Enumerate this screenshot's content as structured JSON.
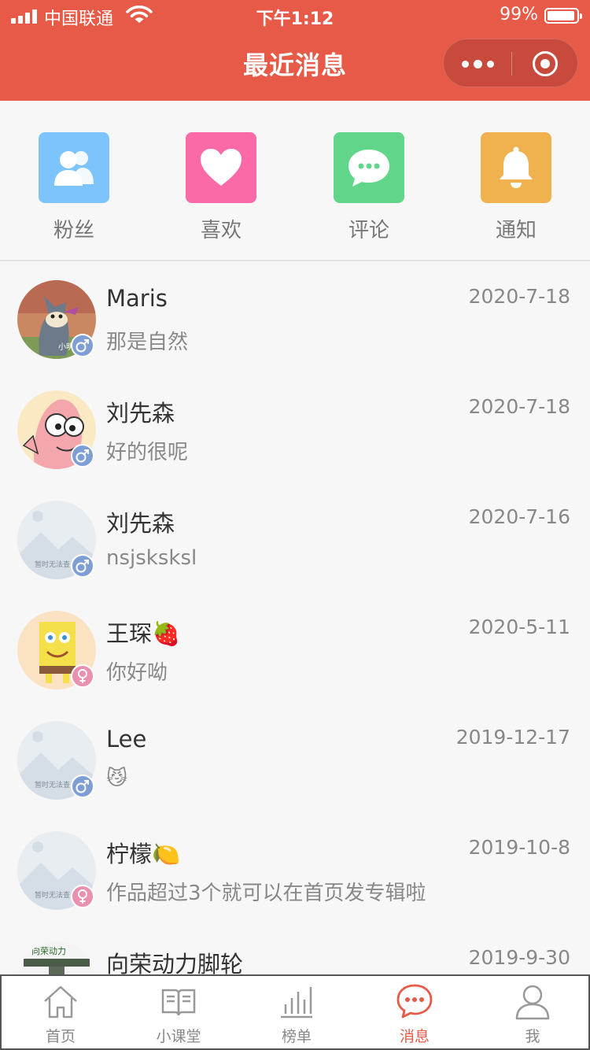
{
  "status_bar": {
    "carrier": "中国联通",
    "time": "下午1:12",
    "battery": "99%"
  },
  "header": {
    "title": "最近消息",
    "accent_color": "#e75a48"
  },
  "categories": [
    {
      "label": "粉丝",
      "icon": "fans-icon",
      "color": "#7cc4fb"
    },
    {
      "label": "喜欢",
      "icon": "heart-icon",
      "color": "#fb6aa6"
    },
    {
      "label": "评论",
      "icon": "comment-icon",
      "color": "#61d68a"
    },
    {
      "label": "通知",
      "icon": "bell-icon",
      "color": "#efb24e"
    }
  ],
  "messages": [
    {
      "name": "Maris",
      "preview": "那是自然",
      "date": "2020-7-18",
      "gender": "male",
      "avatar": "cartoon-cat-avatar"
    },
    {
      "name": "刘先森",
      "preview": "好的很呢",
      "date": "2020-7-18",
      "gender": "male",
      "avatar": "pink-starfish-avatar"
    },
    {
      "name": "刘先森",
      "preview": "nsjsksksl",
      "date": "2020-7-16",
      "gender": "male",
      "avatar": "placeholder-avatar"
    },
    {
      "name": "王琛🍓",
      "preview": "你好呦",
      "date": "2020-5-11",
      "gender": "female",
      "avatar": "yellow-sponge-avatar"
    },
    {
      "name": "Lee",
      "preview": "😼",
      "date": "2019-12-17",
      "gender": "male",
      "avatar": "placeholder-avatar"
    },
    {
      "name": "柠檬🍋",
      "preview": "作品超过3个就可以在首页发专辑啦",
      "date": "2019-10-8",
      "gender": "female",
      "avatar": "placeholder-avatar"
    },
    {
      "name": "向荣动力脚轮",
      "preview": "",
      "date": "2019-9-30",
      "gender": "",
      "avatar": "caster-wheel-avatar"
    }
  ],
  "avatar_placeholder_text": "暂时无法查",
  "tabbar": [
    {
      "label": "首页",
      "icon": "home-icon",
      "active": false
    },
    {
      "label": "小课堂",
      "icon": "book-icon",
      "active": false
    },
    {
      "label": "榜单",
      "icon": "chart-icon",
      "active": false
    },
    {
      "label": "消息",
      "icon": "message-icon",
      "active": true
    },
    {
      "label": "我",
      "icon": "profile-icon",
      "active": false
    }
  ]
}
